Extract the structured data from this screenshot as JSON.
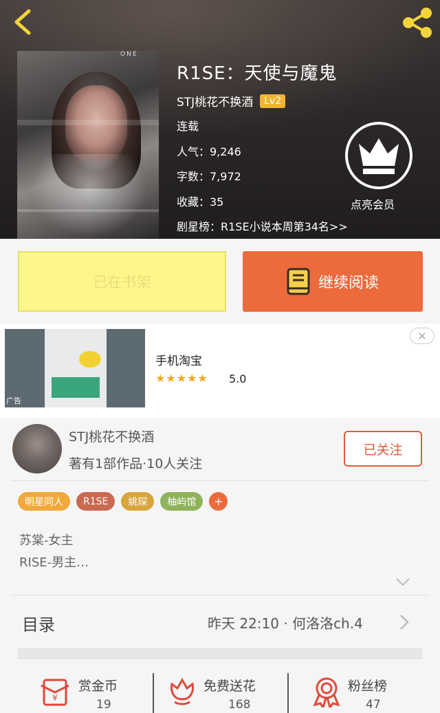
{
  "book": {
    "title": "R1SE：天使与魔鬼",
    "author": "STJ桃花不换酒",
    "level": "Lv2",
    "status": "连载",
    "popularity": "人气：9,246",
    "word_count": "字数：7,972",
    "favorites": "收藏：35",
    "ranking": "剧星榜：R1SE小说本周第34名>>",
    "cover_text": "ONE"
  },
  "vip": {
    "label": "点亮会员"
  },
  "actions": {
    "shelf_label": "已在书架",
    "read_label": "继续阅读"
  },
  "ad": {
    "name": "手机淘宝",
    "stars": "★★★★★",
    "rating": "5.0",
    "ad_tag": "广告",
    "close_symbol": "✕"
  },
  "author": {
    "name": "STJ桃花不换酒",
    "stats": "著有1部作品·10人关注",
    "follow_label": "已关注"
  },
  "tags": [
    {
      "label": "明星同人",
      "color": "#f2a93b"
    },
    {
      "label": "R1SE",
      "color": "#c9694f"
    },
    {
      "label": "姚琛",
      "color": "#d8a53c"
    },
    {
      "label": "柚屿馆",
      "color": "#8fb35a"
    }
  ],
  "tag_add": "+",
  "description": [
    "苏棠-女主",
    "RISE-男主…"
  ],
  "toc": {
    "label": "目录",
    "latest": "昨天 22:10 · 何洛洛ch.4"
  },
  "stats": [
    {
      "label": "赏金币",
      "value": "19",
      "icon": "red-envelope-icon"
    },
    {
      "label": "免费送花",
      "value": "168",
      "icon": "flower-icon"
    },
    {
      "label": "粉丝榜",
      "value": "47",
      "icon": "award-ribbon-icon"
    }
  ],
  "colors": {
    "accent": "#ec6a3c",
    "shelf_bg": "#fdf78b",
    "follow": "#e05a3a",
    "level_badge": "#f1b431"
  }
}
